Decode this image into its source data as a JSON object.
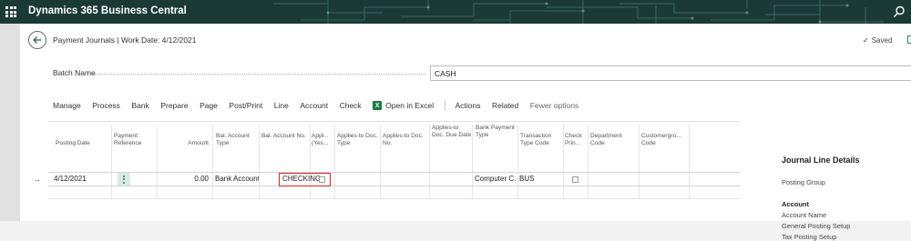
{
  "app": {
    "title": "Dynamics 365 Business Central"
  },
  "page": {
    "title": "Payment Journals | Work Date: 4/12/2021",
    "status": "Saved"
  },
  "batch": {
    "label": "Batch Name",
    "value": "CASH"
  },
  "menu": {
    "items": [
      "Manage",
      "Process",
      "Bank",
      "Prepare",
      "Page",
      "Post/Print",
      "Line",
      "Account",
      "Check"
    ],
    "open_in_excel": "Open in Excel",
    "actions": "Actions",
    "related": "Related",
    "fewer_options": "Fewer options"
  },
  "grid": {
    "headers": {
      "posting_date": "Posting Date",
      "payment_reference": "Payment Reference",
      "amount": "Amount",
      "bal_account_type": "Bal. Account Type",
      "bal_account_no": "Bal. Account No.",
      "applies_yes": "Appl... (Yes...",
      "applies_to_doc_type": "Applies-to Doc. Type",
      "applies_to_doc_no": "Applies-to Doc. No.",
      "applies_to_doc_due_date": "Applies-to Doc. Due Date",
      "bank_payment_type": "Bank Payment Type",
      "transaction_type_code": "Transaction Type Code",
      "check_printed": "Check Prin...",
      "department_code": "Department Code",
      "customergroup_code": "Customergro... Code"
    },
    "row": {
      "posting_date": "4/12/2021",
      "amount": "0.00",
      "bal_account_type": "Bank Account",
      "bal_account_no": "CHECKING",
      "bank_payment_type": "Computer C...",
      "transaction_type_code": "BUS"
    }
  },
  "details": {
    "title": "Journal Line Details",
    "posting_group": "Posting Group",
    "account_header": "Account",
    "account_name": "Account Name",
    "general_posting_setup": "General Posting Setup",
    "tax_posting_setup": "Tax Posting Setup"
  },
  "colors": {
    "topbar": "#1b3a36",
    "accent": "#2e6f5e",
    "highlight": "#d9262c",
    "excel": "#1d7a45"
  }
}
